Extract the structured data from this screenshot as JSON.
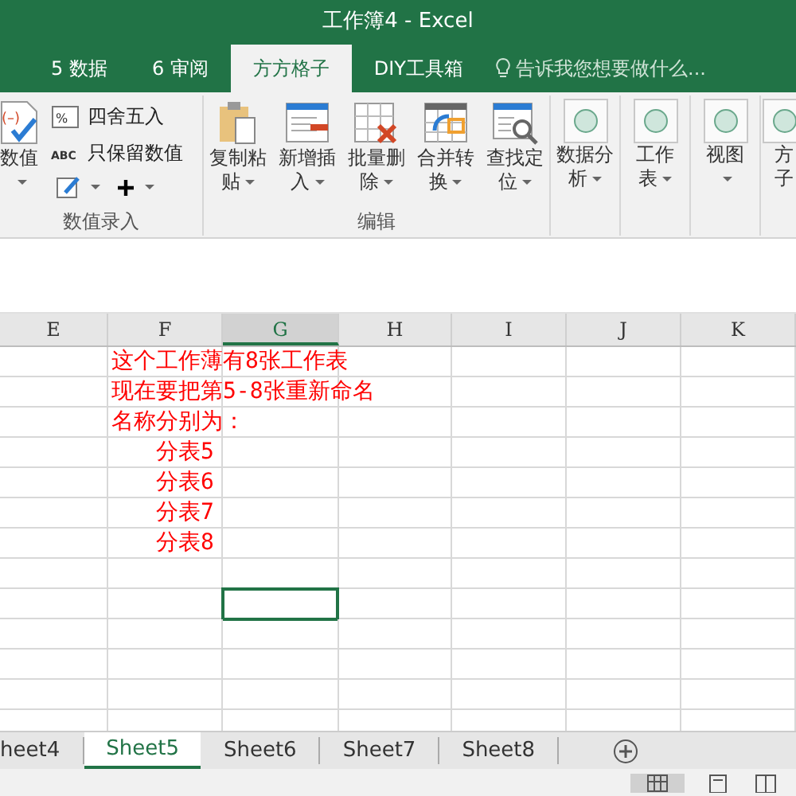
{
  "window": {
    "title": "工作簿4 - Excel"
  },
  "ribbon_tabs": [
    {
      "label": "5 数据",
      "selected": false
    },
    {
      "label": "6 审阅",
      "selected": false
    },
    {
      "label": "方方格子",
      "selected": true
    },
    {
      "label": "DIY工具箱",
      "selected": false
    }
  ],
  "tell_me": {
    "placeholder": "告诉我您想要做什么..."
  },
  "ribbon": {
    "value_group": {
      "label": "数值录入",
      "big_button": {
        "icon_text": "(–)",
        "lines": [
          "数值"
        ]
      },
      "small_buttons": [
        {
          "kind": "percent",
          "icon_text": "%",
          "label": "四舍五入"
        },
        {
          "kind": "abc",
          "icon_text": "ABC",
          "label": "只保留数值"
        }
      ]
    },
    "edit_group": {
      "label": "编辑",
      "buttons": [
        {
          "kind": "clipboard",
          "lines": [
            "复制粘",
            "贴"
          ]
        },
        {
          "kind": "insert",
          "lines": [
            "新增插",
            "入"
          ]
        },
        {
          "kind": "delete",
          "lines": [
            "批量删",
            "除"
          ]
        },
        {
          "kind": "merge",
          "lines": [
            "合并转",
            "换"
          ]
        },
        {
          "kind": "find",
          "lines": [
            "查找定",
            "位"
          ]
        }
      ]
    },
    "circle_groups": [
      {
        "lines": [
          "数据分",
          "析"
        ]
      },
      {
        "lines": [
          "工作",
          "表"
        ]
      },
      {
        "lines": [
          "视图"
        ]
      },
      {
        "lines": [
          "方",
          "子"
        ]
      }
    ]
  },
  "columns": [
    {
      "label": "E",
      "selected": false
    },
    {
      "label": "F",
      "selected": false
    },
    {
      "label": "G",
      "selected": true
    },
    {
      "label": "H",
      "selected": false
    },
    {
      "label": "I",
      "selected": false
    },
    {
      "label": "J",
      "selected": false
    },
    {
      "label": "K",
      "selected": false
    }
  ],
  "rows": [
    {
      "text": "这个工作薄有8张工作表",
      "indent": false,
      "selected": false
    },
    {
      "text": "现在要把第5-8张重新命名",
      "indent": false,
      "selected": false
    },
    {
      "text": "名称分别为：",
      "indent": false,
      "selected": false
    },
    {
      "text": "分表5",
      "indent": true,
      "selected": false
    },
    {
      "text": "分表6",
      "indent": true,
      "selected": false
    },
    {
      "text": "分表7",
      "indent": true,
      "selected": false
    },
    {
      "text": "分表8",
      "indent": true,
      "selected": false
    },
    {
      "selected": false
    },
    {
      "selected": true
    },
    {
      "selected": false
    },
    {
      "selected": false
    },
    {
      "selected": false
    },
    {
      "selected": false
    }
  ],
  "sheet_tabs": [
    {
      "label": "heet4",
      "selected": false
    },
    {
      "label": "Sheet5",
      "selected": true
    },
    {
      "label": "Sheet6",
      "selected": false
    },
    {
      "label": "Sheet7",
      "selected": false
    },
    {
      "label": "Sheet8",
      "selected": false
    }
  ]
}
